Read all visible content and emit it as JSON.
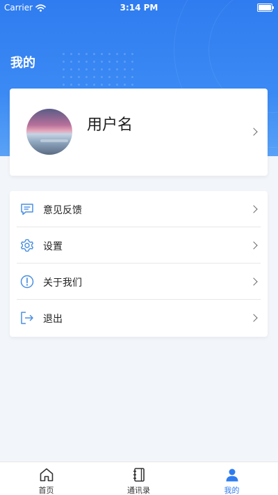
{
  "status_bar": {
    "carrier": "Carrier",
    "time": "3:14 PM"
  },
  "page": {
    "title": "我的"
  },
  "profile": {
    "username": "用户名"
  },
  "menu": [
    {
      "label": "意见反馈",
      "icon": "feedback-icon"
    },
    {
      "label": "设置",
      "icon": "gear-icon"
    },
    {
      "label": "关于我们",
      "icon": "info-icon"
    },
    {
      "label": "退出",
      "icon": "logout-icon"
    }
  ],
  "tabbar": {
    "items": [
      {
        "label": "首页",
        "icon": "home-icon"
      },
      {
        "label": "通讯录",
        "icon": "contacts-book-icon"
      },
      {
        "label": "我的",
        "icon": "user-icon"
      }
    ],
    "active_index": 2
  },
  "colors": {
    "accent": "#2f7cf0",
    "icon_outline": "#4a8fe0"
  }
}
